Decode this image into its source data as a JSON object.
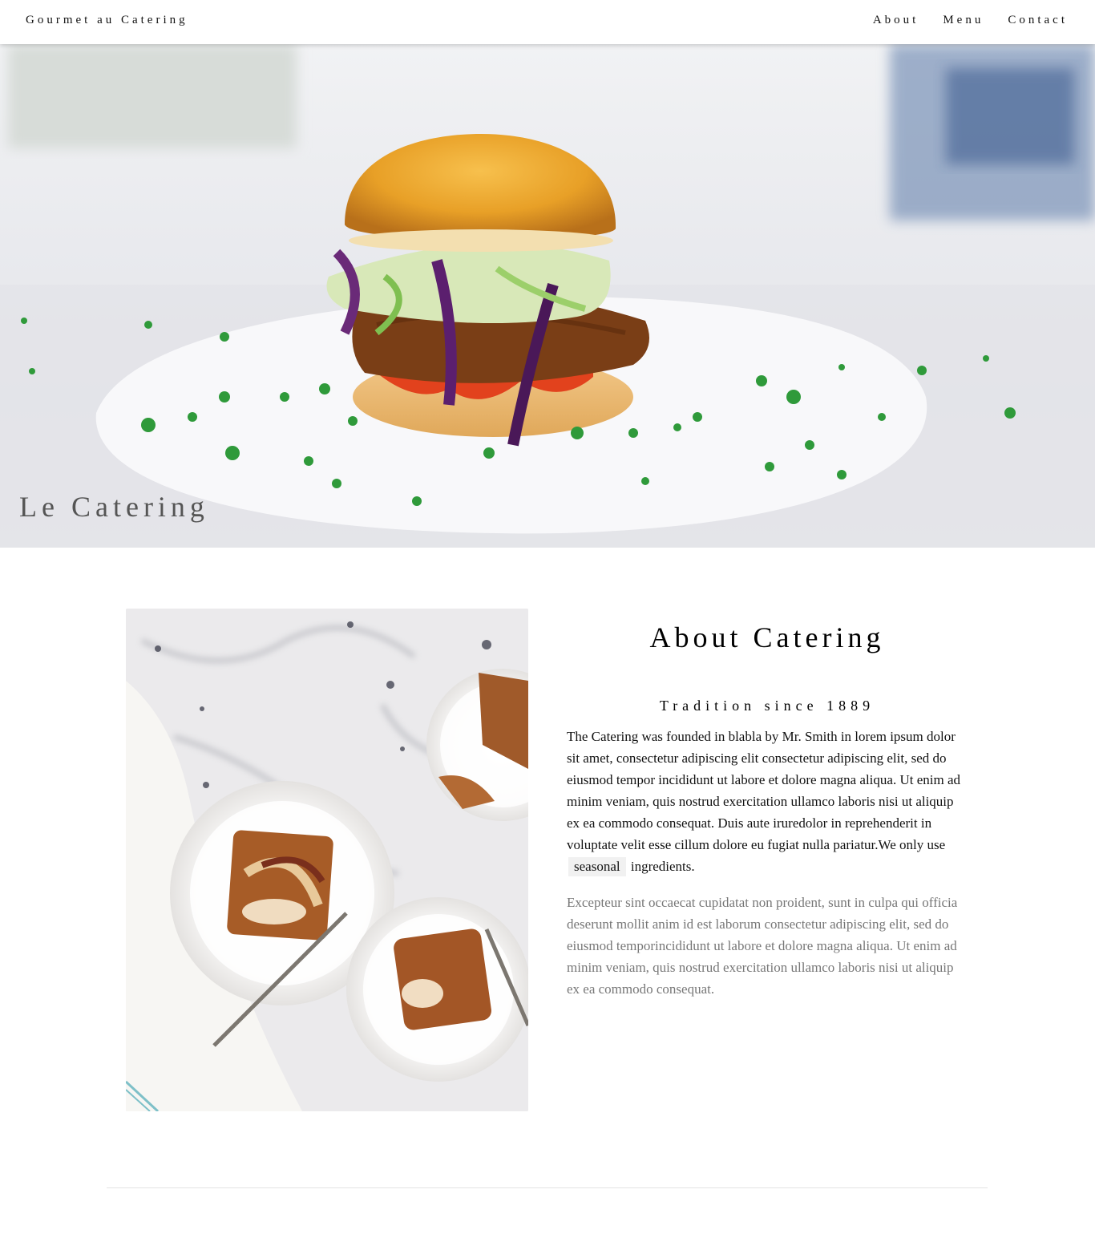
{
  "header": {
    "brand": "Gourmet au Catering",
    "nav": [
      {
        "label": "About"
      },
      {
        "label": "Menu"
      },
      {
        "label": "Contact"
      }
    ]
  },
  "hero": {
    "title": "Le Catering",
    "image": "burger-photo"
  },
  "about": {
    "image": "apple-tart-photo",
    "title": "About Catering",
    "subtitle": "Tradition since 1889",
    "paragraph1_before": "The Catering was founded in blabla by Mr. Smith in lorem ipsum dolor sit amet, consectetur adipiscing elit consectetur adipiscing elit, sed do eiusmod tempor incididunt ut labore et dolore magna aliqua. Ut enim ad minim veniam, quis nostrud exercitation ullamco laboris nisi ut aliquip ex ea commodo consequat. Duis aute iruredolor in reprehenderit in voluptate velit esse cillum dolore eu fugiat nulla pariatur.We only use",
    "highlight": "seasonal",
    "paragraph1_after": "ingredients.",
    "paragraph2": "Excepteur sint occaecat cupidatat non proident, sunt in culpa qui officia deserunt mollit anim id est laborum consectetur adipiscing elit, sed do eiusmod temporincididunt ut labore et dolore magna aliqua. Ut enim ad minim veniam, quis nostrud exercitation ullamco laboris nisi ut aliquip ex ea commodo consequat."
  },
  "colors": {
    "text": "#000000",
    "muted_text": "#777777",
    "tag_bg": "#f1f1f1",
    "hero_title": "#555555"
  }
}
